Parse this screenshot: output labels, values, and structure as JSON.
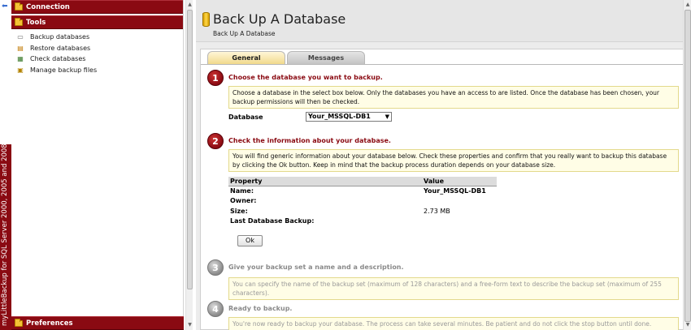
{
  "app": {
    "vertical_title": "myLittleBackup for SQL Server 2000, 2005 and 2008"
  },
  "sidebar": {
    "connection_label": "Connection",
    "tools_label": "Tools",
    "items": [
      {
        "label": "Backup databases",
        "icon": "backup-drive-icon"
      },
      {
        "label": "Restore databases",
        "icon": "restore-icon"
      },
      {
        "label": "Check databases",
        "icon": "check-icon"
      },
      {
        "label": "Manage backup files",
        "icon": "files-icon"
      }
    ],
    "preferences_label": "Preferences"
  },
  "page": {
    "title": "Back Up A Database",
    "breadcrumb": "Back Up A Database"
  },
  "tabs": [
    {
      "label": "General",
      "active": true
    },
    {
      "label": "Messages",
      "active": false
    }
  ],
  "steps": [
    {
      "number": "1",
      "title": "Choose the database you want to backup.",
      "description": "Choose a database in the select box below. Only the databases you have an access to are listed. Once the database has been chosen, your backup permissions will then be checked."
    },
    {
      "number": "2",
      "title": "Check the information about your database.",
      "description": "You will find generic information about your database below. Check these properties and confirm that you really want to backup this database by clicking the Ok button. Keep in mind that the backup process duration depends on your database size."
    },
    {
      "number": "3",
      "title": "Give your backup set a name and a description.",
      "description": "You can specify the name of the backup set (maximum of 128 characters) and a free-form text to describe the backup set (maximum of 255 characters)."
    },
    {
      "number": "4",
      "title": "Ready to backup.",
      "description": "You're now ready to backup your database. The process can take several minutes. Be patient and do not click the stop button until done."
    }
  ],
  "database_select": {
    "label": "Database",
    "value": "Your_MSSQL-DB1"
  },
  "properties": {
    "headers": [
      "Property",
      "Value"
    ],
    "rows": [
      {
        "property": "Name:",
        "value": "Your_MSSQL-DB1"
      },
      {
        "property": "Owner:",
        "value": ""
      },
      {
        "property": "Size:",
        "value": "2.73 MB"
      },
      {
        "property": "Last Database Backup:",
        "value": ""
      }
    ]
  },
  "ok_button": "Ok",
  "colors": {
    "brand": "#8a0a12",
    "info_bg": "#fffde6",
    "tab_active": "#f1d98c"
  }
}
